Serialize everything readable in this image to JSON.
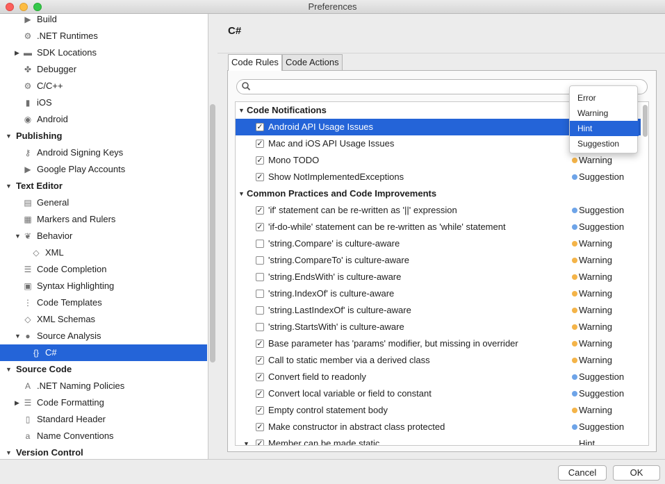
{
  "window": {
    "title": "Preferences"
  },
  "sidebar": {
    "items": [
      {
        "label": "Build",
        "icon": "build-icon",
        "glyph": "▶",
        "level": 2
      },
      {
        "label": ".NET Runtimes",
        "icon": "gear-icon",
        "glyph": "⚙",
        "level": 2
      },
      {
        "label": "SDK Locations",
        "icon": "folder-icon",
        "glyph": "▬",
        "level": 2,
        "arrow": "▶"
      },
      {
        "label": "Debugger",
        "icon": "bug-icon",
        "glyph": "✤",
        "level": 2
      },
      {
        "label": "C/C++",
        "icon": "gear-icon",
        "glyph": "⚙",
        "level": 2
      },
      {
        "label": "iOS",
        "icon": "phone-icon",
        "glyph": "▮",
        "level": 2
      },
      {
        "label": "Android",
        "icon": "android-icon",
        "glyph": "◉",
        "level": 2
      },
      {
        "label": "Publishing",
        "level": 1,
        "arrow": "▼"
      },
      {
        "label": "Android Signing Keys",
        "icon": "key-icon",
        "glyph": "⚷",
        "level": 2
      },
      {
        "label": "Google Play Accounts",
        "icon": "play-icon",
        "glyph": "▶",
        "level": 2
      },
      {
        "label": "Text Editor",
        "level": 1,
        "arrow": "▼"
      },
      {
        "label": "General",
        "icon": "settings-panel-icon",
        "glyph": "▤",
        "level": 2
      },
      {
        "label": "Markers and Rulers",
        "icon": "ruler-icon",
        "glyph": "▦",
        "level": 2
      },
      {
        "label": "Behavior",
        "icon": "brain-icon",
        "glyph": "❦",
        "level": 2,
        "arrow": "▼"
      },
      {
        "label": "XML",
        "icon": "xml-file-icon",
        "glyph": "◇",
        "level": 3
      },
      {
        "label": "Code Completion",
        "icon": "list-icon",
        "glyph": "☰",
        "level": 2
      },
      {
        "label": "Syntax Highlighting",
        "icon": "highlight-icon",
        "glyph": "▣",
        "level": 2
      },
      {
        "label": "Code Templates",
        "icon": "template-icon",
        "glyph": "⋮",
        "level": 2
      },
      {
        "label": "XML Schemas",
        "icon": "xml-schema-icon",
        "glyph": "◇",
        "level": 2
      },
      {
        "label": "Source Analysis",
        "icon": "analysis-dot-icon",
        "glyph": "●",
        "level": 2,
        "arrow": "▼"
      },
      {
        "label": "C#",
        "icon": "csharp-file-icon",
        "glyph": "{}",
        "level": 3,
        "selected": true
      },
      {
        "label": "Source Code",
        "level": 1,
        "arrow": "▼"
      },
      {
        "label": ".NET Naming Policies",
        "icon": "naming-icon",
        "glyph": "A",
        "level": 2
      },
      {
        "label": "Code Formatting",
        "icon": "formatting-icon",
        "glyph": "☰",
        "level": 2,
        "arrow": "▶"
      },
      {
        "label": "Standard Header",
        "icon": "document-icon",
        "glyph": "▯",
        "level": 2
      },
      {
        "label": "Name Conventions",
        "icon": "conventions-icon",
        "glyph": "a",
        "level": 2
      },
      {
        "label": "Version Control",
        "level": 1,
        "arrow": "▼"
      }
    ]
  },
  "main": {
    "title": "C#",
    "tabs": [
      {
        "label": "Code Rules",
        "active": true
      },
      {
        "label": "Code Actions",
        "active": false
      }
    ],
    "search": {
      "placeholder": ""
    },
    "rows": [
      {
        "type": "category",
        "label": "Code Notifications"
      },
      {
        "type": "rule",
        "checked": true,
        "label": "Android API Usage Issues",
        "severity": "",
        "selected": true
      },
      {
        "type": "rule",
        "checked": true,
        "label": "Mac and iOS API Usage Issues",
        "severity": ""
      },
      {
        "type": "rule",
        "checked": true,
        "label": "Mono TODO",
        "severity": "Warning"
      },
      {
        "type": "rule",
        "checked": true,
        "label": "Show NotImplementedExceptions",
        "severity": "Suggestion"
      },
      {
        "type": "category",
        "label": "Common Practices and Code Improvements"
      },
      {
        "type": "rule",
        "checked": true,
        "label": "'if' statement can be re-written as '||' expression",
        "severity": "Suggestion"
      },
      {
        "type": "rule",
        "checked": true,
        "label": "'if-do-while' statement can be re-written as 'while' statement",
        "severity": "Suggestion"
      },
      {
        "type": "rule",
        "checked": false,
        "label": "'string.Compare' is culture-aware",
        "severity": "Warning"
      },
      {
        "type": "rule",
        "checked": false,
        "label": "'string.CompareTo' is culture-aware",
        "severity": "Warning"
      },
      {
        "type": "rule",
        "checked": false,
        "label": "'string.EndsWith' is culture-aware",
        "severity": "Warning"
      },
      {
        "type": "rule",
        "checked": false,
        "label": "'string.IndexOf' is culture-aware",
        "severity": "Warning"
      },
      {
        "type": "rule",
        "checked": false,
        "label": "'string.LastIndexOf' is culture-aware",
        "severity": "Warning"
      },
      {
        "type": "rule",
        "checked": false,
        "label": "'string.StartsWith' is culture-aware",
        "severity": "Warning"
      },
      {
        "type": "rule",
        "checked": true,
        "label": "Base parameter has 'params' modifier, but missing in overrider",
        "severity": "Warning"
      },
      {
        "type": "rule",
        "checked": true,
        "label": "Call to static member via a derived class",
        "severity": "Warning"
      },
      {
        "type": "rule",
        "checked": true,
        "label": "Convert field to readonly",
        "severity": "Suggestion"
      },
      {
        "type": "rule",
        "checked": true,
        "label": "Convert local variable or field to constant",
        "severity": "Suggestion"
      },
      {
        "type": "rule",
        "checked": true,
        "label": "Empty control statement body",
        "severity": "Warning"
      },
      {
        "type": "rule",
        "checked": true,
        "label": "Make constructor in abstract class protected",
        "severity": "Suggestion"
      },
      {
        "type": "rule",
        "checked": true,
        "label": "Member can be made static",
        "severity": "Hint",
        "arrow": "▼"
      }
    ]
  },
  "severity_popup": {
    "options": [
      "Error",
      "Warning",
      "Hint",
      "Suggestion"
    ],
    "highlighted": "Hint"
  },
  "footer": {
    "cancel": "Cancel",
    "ok": "OK"
  },
  "colors": {
    "selection": "#2464d8",
    "warning_dot": "#f4b449",
    "suggestion_dot": "#6ea4e8"
  }
}
